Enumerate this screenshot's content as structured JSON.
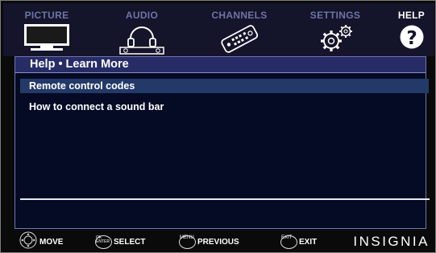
{
  "tabs": [
    {
      "label": "PICTURE",
      "icon": "tv-icon",
      "active": false
    },
    {
      "label": "AUDIO",
      "icon": "headphones-icon",
      "active": false
    },
    {
      "label": "CHANNELS",
      "icon": "remote-control-icon",
      "active": false
    },
    {
      "label": "SETTINGS",
      "icon": "gears-icon",
      "active": false
    },
    {
      "label": "HELP",
      "icon": "question-mark-icon",
      "active": true
    }
  ],
  "panel": {
    "title": "Help • Learn More",
    "items": [
      {
        "label": "Remote control codes",
        "selected": true
      },
      {
        "label": "How to connect a sound bar",
        "selected": false
      }
    ]
  },
  "hints": {
    "move": "MOVE",
    "select_key": "OK",
    "select_key_sub": "ENTER",
    "select": "SELECT",
    "menu_key": "MENU",
    "previous": "PREVIOUS",
    "exit_key": "EXIT",
    "exit": "EXIT"
  },
  "brand": "INSIGNIA",
  "colors": {
    "highlight": "#233a68",
    "title_bar": "#272c66",
    "inactive_tab": "#6e74a8"
  }
}
